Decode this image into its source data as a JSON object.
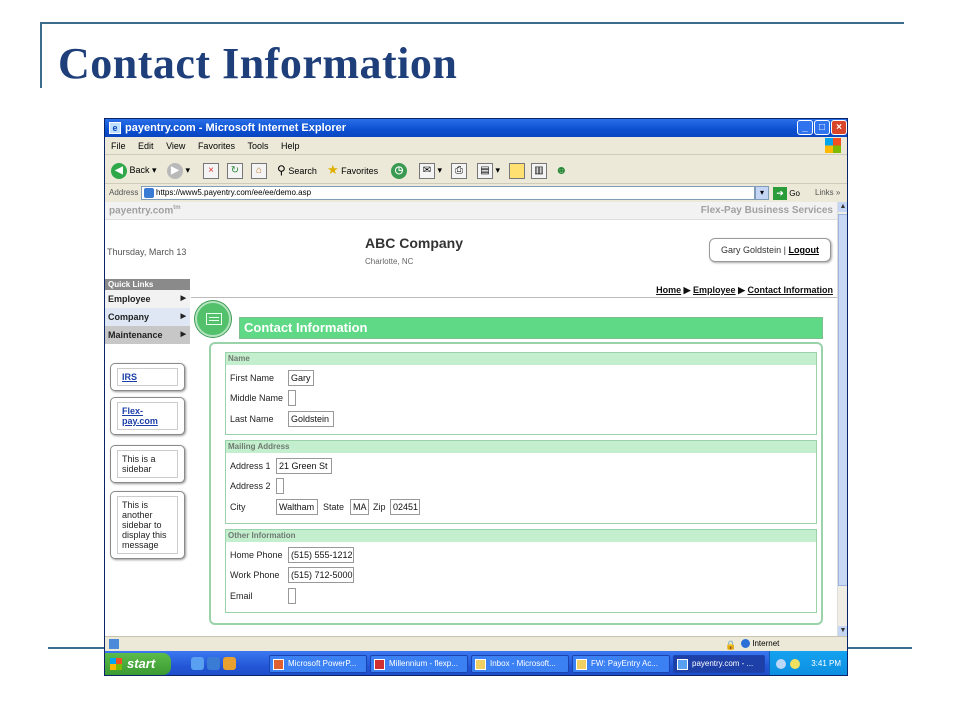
{
  "slide": {
    "title": "Contact Information"
  },
  "window": {
    "title": "payentry.com - Microsoft Internet Explorer",
    "menu": [
      "File",
      "Edit",
      "View",
      "Favorites",
      "Tools",
      "Help"
    ],
    "toolbar": {
      "back_label": "Back",
      "search_label": "Search",
      "favorites_label": "Favorites"
    },
    "address": {
      "label": "Address",
      "url": "https://www5.payentry.com/ee/ee/demo.asp",
      "go_label": "Go",
      "links_label": "Links"
    }
  },
  "site": {
    "logo": "payentry.com",
    "logo_tm": "tm",
    "brand": "Flex-Pay Business Services",
    "date": "Thursday, March 13",
    "company_name": "ABC Company",
    "company_location": "Charlotte, NC",
    "user_name": "Gary Goldstein",
    "separator": "|",
    "logout_label": "Logout",
    "quick_links_header": "Quick Links",
    "nav": [
      "Employee",
      "Company",
      "Maintenance"
    ],
    "sidebar": {
      "irs_link": "IRS",
      "flexpay_link": "Flex-pay.com",
      "message1": "This is a sidebar",
      "message2": "This is another sidebar to display this message"
    },
    "breadcrumb": {
      "home": "Home",
      "employee": "Employee",
      "current": "Contact Information"
    },
    "section_title": "Contact Information"
  },
  "form": {
    "name_section": {
      "header": "Name",
      "first_name_label": "First Name",
      "first_name": "Gary",
      "middle_name_label": "Middle Name",
      "middle_name": "",
      "last_name_label": "Last Name",
      "last_name": "Goldstein"
    },
    "mailing_section": {
      "header": "Mailing Address",
      "address1_label": "Address 1",
      "address1": "21 Green St",
      "address2_label": "Address 2",
      "address2": "",
      "city_label": "City",
      "city": "Waltham",
      "state_label": "State",
      "state": "MA",
      "zip_label": "Zip",
      "zip": "02451"
    },
    "other_section": {
      "header": "Other Information",
      "home_phone_label": "Home Phone",
      "home_phone": "(515) 555-1212",
      "work_phone_label": "Work Phone",
      "work_phone": "(515) 712-5000",
      "email_label": "Email",
      "email": ""
    }
  },
  "statusbar": {
    "zone": "Internet"
  },
  "taskbar": {
    "start_label": "start",
    "tasks": [
      "Microsoft PowerP...",
      "Millennium - flexp...",
      "Inbox - Microsoft...",
      "FW: PayEntry Ac...",
      "payentry.com - ..."
    ],
    "clock": "3:41 PM"
  },
  "colors": {
    "accent_green": "#5fd986",
    "title_blue": "#1f3f7a",
    "xp_blue": "#2356d6"
  }
}
